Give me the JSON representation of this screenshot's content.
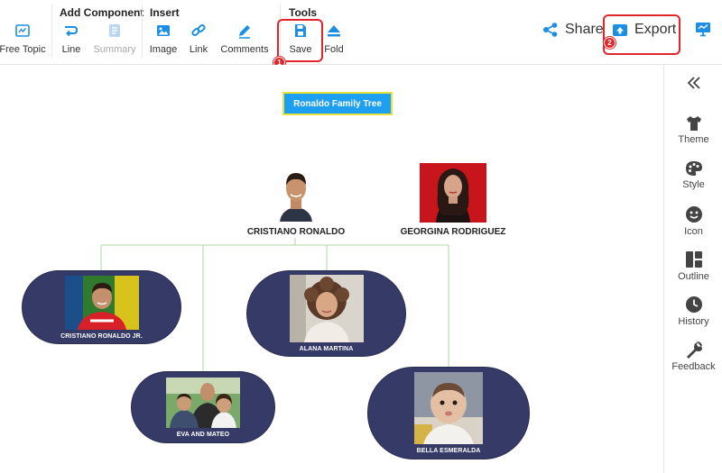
{
  "toolbar": {
    "groups": {
      "add_component": "Add Component",
      "insert": "Insert",
      "tools": "Tools"
    },
    "items": {
      "free_topic": "Free Topic",
      "line": "Line",
      "summary": "Summary",
      "image": "Image",
      "link": "Link",
      "comments": "Comments",
      "save": "Save",
      "fold": "Fold"
    },
    "share": "Share",
    "export": "Export",
    "badges": {
      "save": "1",
      "export": "2"
    },
    "accent": "#1a8fe3",
    "highlight": "#e0262a"
  },
  "canvas": {
    "title": "Ronaldo Family Tree",
    "parents": {
      "father": "CRISTIANO RONALDO",
      "mother": "GEORGINA RODRIGUEZ"
    },
    "children": {
      "jr": "CRISTIANO RONALDO JR.",
      "alana": "ALANA MARTINA",
      "eva_mateo": "EVA AND MATEO",
      "bella": "BELLA ESMERALDA"
    },
    "node_color": "#363a67",
    "title_color": "#1ea0f2"
  },
  "sidebar": {
    "items": {
      "theme": "Theme",
      "style": "Style",
      "icon": "Icon",
      "outline": "Outline",
      "history": "History",
      "feedback": "Feedback"
    }
  }
}
